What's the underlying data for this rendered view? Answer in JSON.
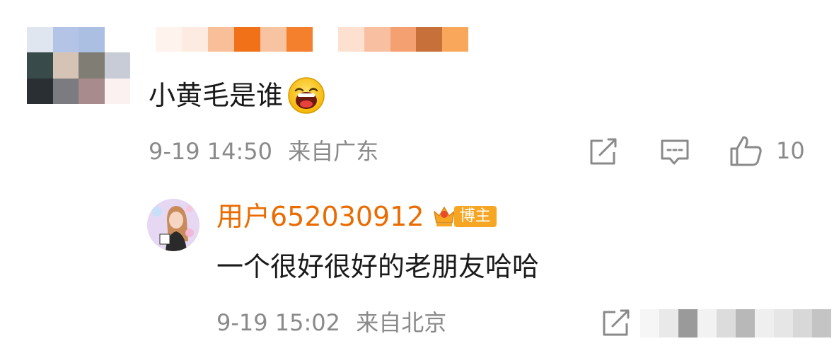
{
  "comment": {
    "text": "小黄毛是谁",
    "timestamp": "9-19 14:50",
    "location": "来自广东",
    "like_count": "10",
    "emoji_icon": "laughing-face-emoji"
  },
  "reply": {
    "username": "用户652030912",
    "badge_label": "博主",
    "badge_icon": "crown-icon",
    "text": "一个很好很好的老朋友哈哈",
    "timestamp": "9-19 15:02",
    "location": "来自北京"
  },
  "icons": {
    "share": "share-icon",
    "comment": "comment-icon",
    "like": "thumbs-up-icon"
  },
  "colors": {
    "username_orange": "#ea6b00",
    "meta_gray": "#8a8a8a",
    "badge_orange": "#f6a623"
  }
}
